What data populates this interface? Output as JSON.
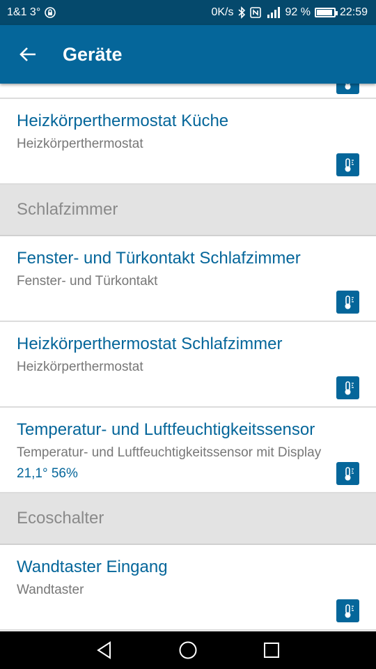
{
  "status_bar": {
    "left_text": "1&1 3°",
    "speed": "0K/s",
    "battery": "92 %",
    "battery_level": 0.92,
    "time": "22:59"
  },
  "app_bar": {
    "title": "Geräte"
  },
  "sections": [
    {
      "header": "",
      "devices": [
        {
          "name": "Heizkörperthermostat Küche",
          "type": "Heizkörperthermostat",
          "value": ""
        }
      ]
    },
    {
      "header": "Schlafzimmer",
      "devices": [
        {
          "name": "Fenster- und Türkontakt Schlafzimmer",
          "type": "Fenster- und Türkontakt",
          "value": ""
        },
        {
          "name": "Heizkörperthermostat Schlafzimmer",
          "type": "Heizkörperthermostat",
          "value": ""
        },
        {
          "name": "Temperatur- und Luftfeuchtigkeitssensor",
          "type": "Temperatur- und Luftfeuchtigkeitssensor mit Display",
          "value": "21,1° 56%"
        }
      ]
    },
    {
      "header": "Ecoschalter",
      "devices": [
        {
          "name": "Wandtaster Eingang",
          "type": "Wandtaster",
          "value": ""
        }
      ]
    }
  ],
  "icons": {
    "device_action": "thermometer-icon",
    "back": "arrow-left-icon"
  },
  "colors": {
    "status_bar": "#05496c",
    "app_bar": "#05669a",
    "accent": "#05669a",
    "section_bg": "#e3e3e3"
  }
}
